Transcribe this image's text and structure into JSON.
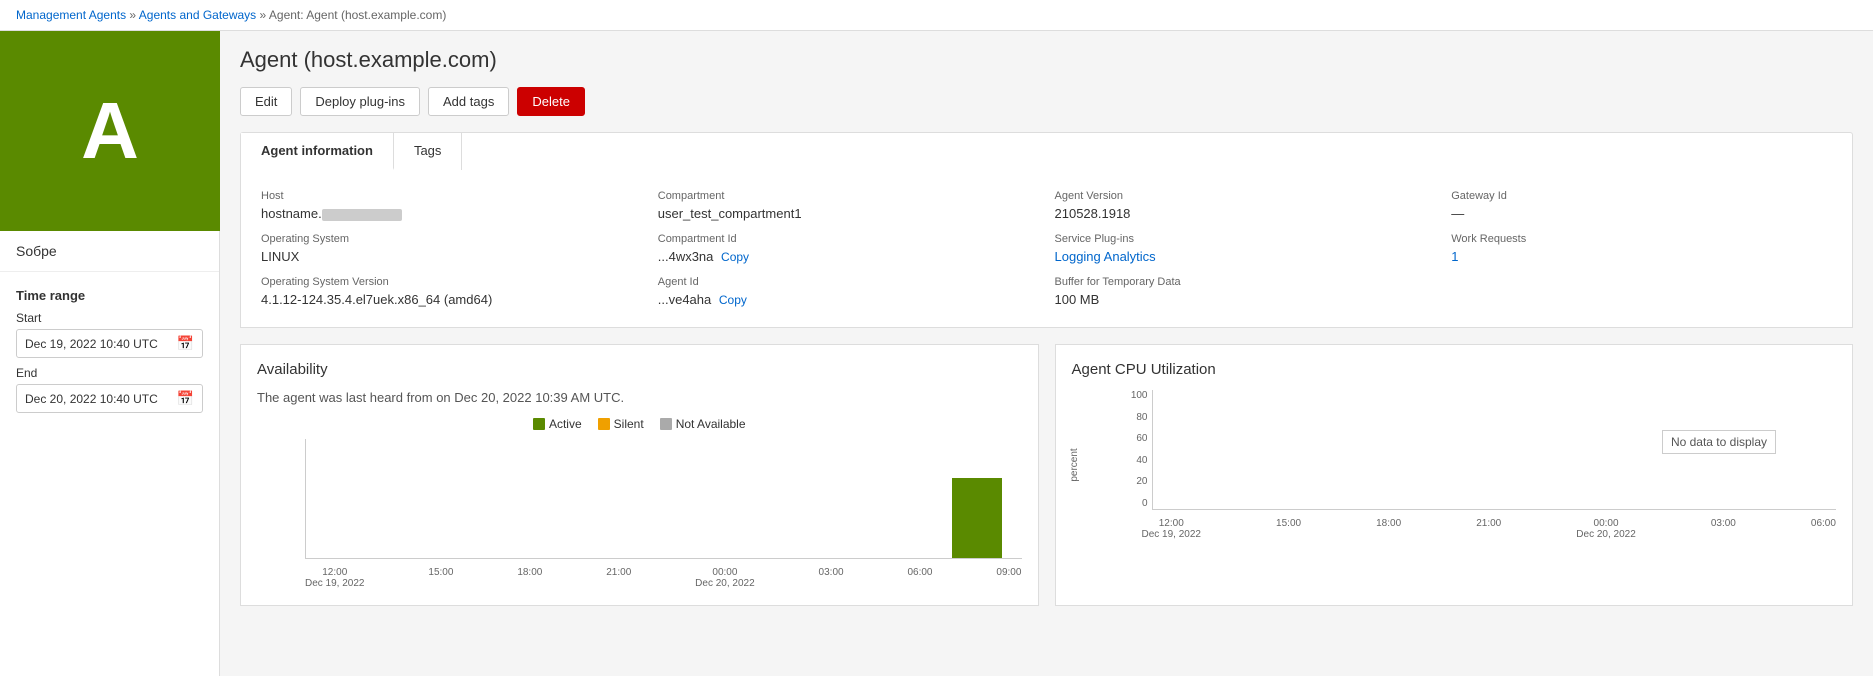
{
  "breadcrumb": {
    "root": "Management Agents",
    "separator1": " » ",
    "section": "Agents and Gateways",
    "separator2": " » ",
    "current": "Agent: Agent (host.example.com)"
  },
  "page": {
    "title": "Agent (host.example.com)"
  },
  "actions": {
    "edit": "Edit",
    "deploy": "Deploy plug-ins",
    "add_tags": "Add tags",
    "delete": "Delete"
  },
  "tabs": [
    {
      "id": "agent-info",
      "label": "Agent information",
      "active": true
    },
    {
      "id": "tags",
      "label": "Tags",
      "active": false
    }
  ],
  "agent_info": {
    "host_label": "Host",
    "host_value": "hostname.",
    "os_label": "Operating System",
    "os_value": "LINUX",
    "os_version_label": "Operating System Version",
    "os_version_value": "4.1.12-124.35.4.el7uek.x86_64 (amd64)",
    "compartment_label": "Compartment",
    "compartment_value": "user_test_compartment1",
    "compartment_id_label": "Compartment Id",
    "compartment_id_value": "...4wx3na",
    "compartment_id_copy": "Copy",
    "agent_id_label": "Agent Id",
    "agent_id_value": "...ve4aha",
    "agent_id_copy": "Copy",
    "agent_version_label": "Agent Version",
    "agent_version_value": "210528.1918",
    "service_plugins_label": "Service Plug-ins",
    "service_plugins_value": "Logging Analytics",
    "buffer_label": "Buffer for Temporary Data",
    "buffer_value": "100 MB",
    "gateway_id_label": "Gateway Id",
    "gateway_id_value": "—",
    "work_requests_label": "Work Requests",
    "work_requests_value": "1"
  },
  "sidebar": {
    "avatar_letter": "A",
    "username": "Sобре"
  },
  "time_range": {
    "title": "Time range",
    "start_label": "Start",
    "start_value": "Dec 19, 2022 10:40 UTC",
    "end_label": "End",
    "end_value": "Dec 20, 2022 10:40 UTC"
  },
  "availability": {
    "title": "Availability",
    "message": "The agent was last heard from on Dec 20, 2022 10:39 AM UTC.",
    "legend": [
      {
        "label": "Active",
        "color": "#5a8a00"
      },
      {
        "label": "Silent",
        "color": "#f0a000"
      },
      {
        "label": "Not Available",
        "color": "#aaa"
      }
    ],
    "x_labels": [
      {
        "time": "12:00",
        "date": "Dec 19, 2022"
      },
      {
        "time": "15:00",
        "date": ""
      },
      {
        "time": "18:00",
        "date": ""
      },
      {
        "time": "21:00",
        "date": ""
      },
      {
        "time": "00:00",
        "date": "Dec 20, 2022"
      },
      {
        "time": "03:00",
        "date": ""
      },
      {
        "time": "06:00",
        "date": ""
      },
      {
        "time": "09:00",
        "date": ""
      }
    ]
  },
  "cpu": {
    "title": "Agent CPU Utilization",
    "no_data": "No data to display",
    "y_labels": [
      "100",
      "80",
      "60",
      "40",
      "20",
      "0"
    ],
    "y_axis_label": "percent",
    "x_labels": [
      {
        "time": "12:00",
        "date": "Dec 19, 2022"
      },
      {
        "time": "15:00",
        "date": ""
      },
      {
        "time": "18:00",
        "date": ""
      },
      {
        "time": "21:00",
        "date": ""
      },
      {
        "time": "00:00",
        "date": "Dec 20, 2022"
      },
      {
        "time": "03:00",
        "date": ""
      },
      {
        "time": "06:00",
        "date": ""
      }
    ]
  }
}
